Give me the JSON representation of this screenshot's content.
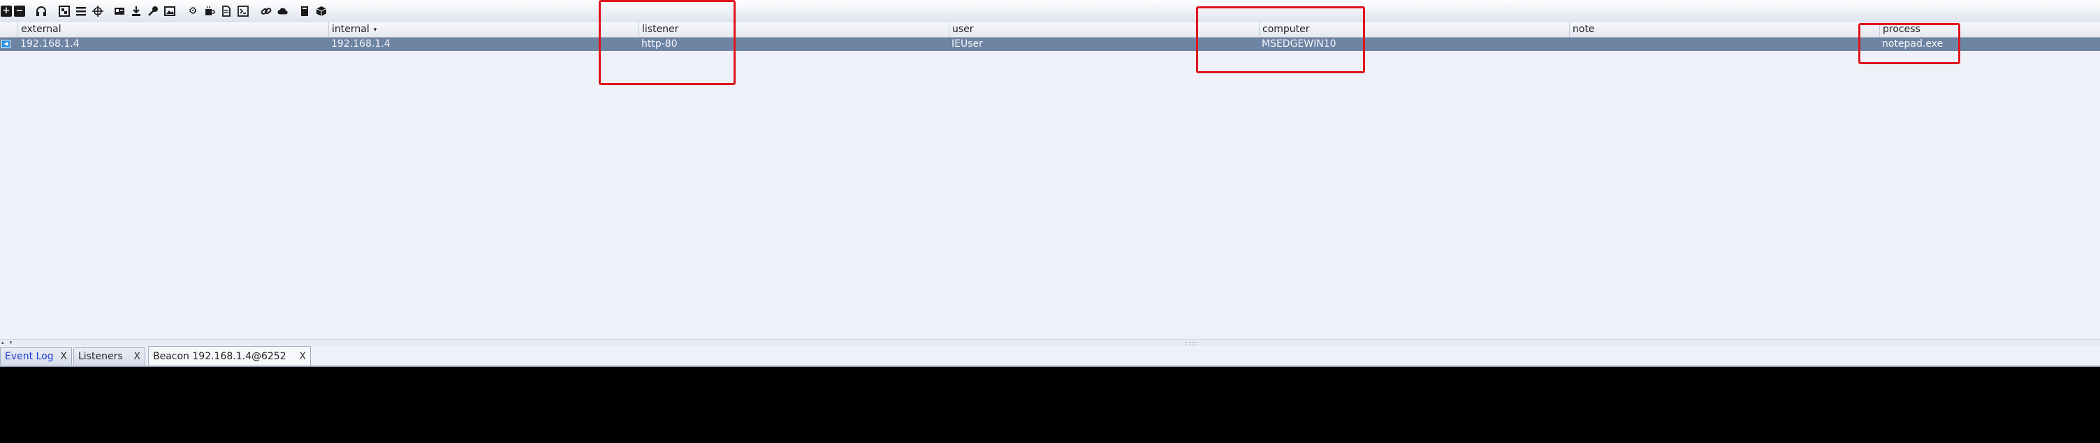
{
  "toolbar": {
    "icons": [
      "add-icon",
      "remove-icon",
      "headphones-icon",
      "pivot-graph-icon",
      "list-view-icon",
      "target-icon",
      "credentials-icon",
      "download-icon",
      "key-icon",
      "image-icon",
      "settings-icon",
      "coffee-icon",
      "document-icon",
      "console-icon",
      "link-icon",
      "cloud-icon",
      "book-icon",
      "package-icon"
    ]
  },
  "table": {
    "columns": [
      "external",
      "internal",
      "listener",
      "user",
      "computer",
      "note",
      "process"
    ],
    "sort_indicator": "▾",
    "rows": [
      {
        "icon": "beacon-icon",
        "external": "192.168.1.4",
        "internal": "192.168.1.4",
        "listener": "http-80",
        "user": "IEUser",
        "computer": "MSEDGEWIN10",
        "note": "",
        "process": "notepad.exe"
      }
    ]
  },
  "split": {
    "arrows": "▴ ▾"
  },
  "tabs": [
    {
      "label": "Event Log",
      "close": "X"
    },
    {
      "label": "Listeners",
      "close": "X"
    },
    {
      "label": "Beacon 192.168.1.4@6252",
      "close": "X"
    }
  ],
  "colors": {
    "selected_row": "#6d84a3",
    "annotation": "#e0141c",
    "console_bg": "#000000",
    "link_tab": "#1d3fd8"
  }
}
